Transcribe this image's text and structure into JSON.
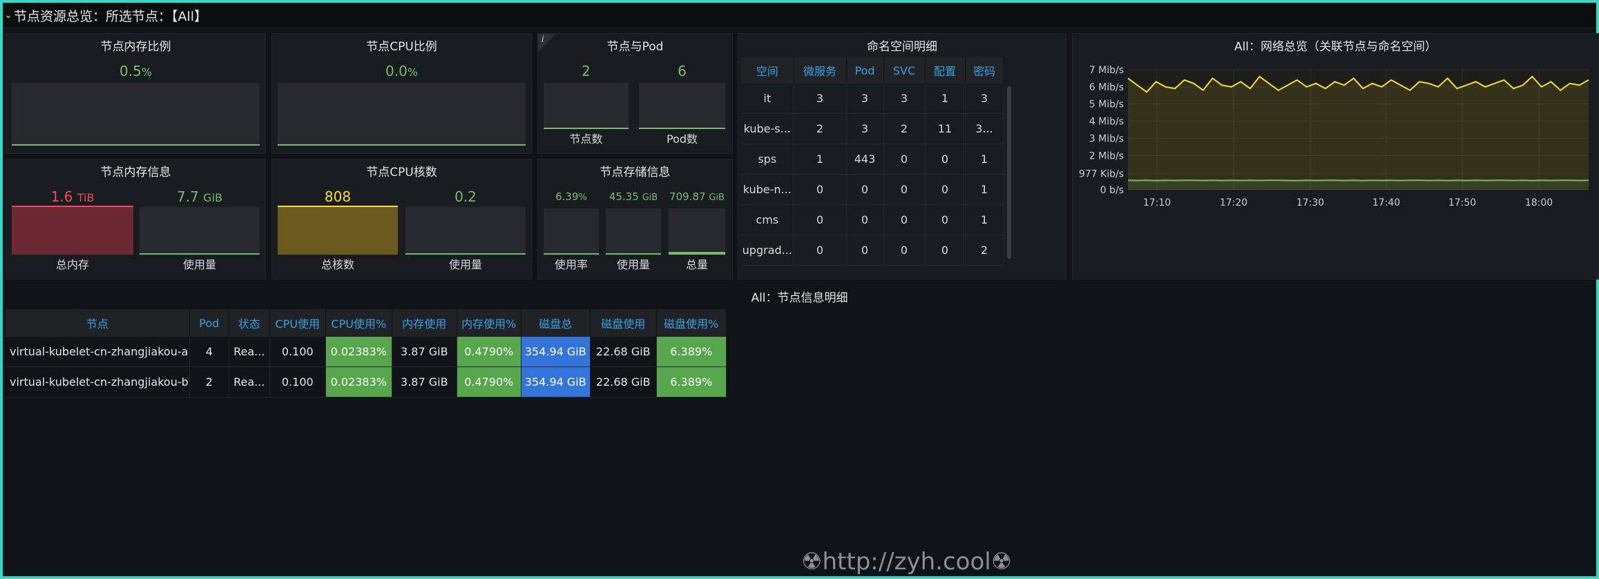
{
  "row": {
    "title": "节点资源总览：所选节点：【All】"
  },
  "mem_ratio": {
    "title": "节点内存比例",
    "value": "0.5",
    "unit": "%",
    "percent": 0.5
  },
  "cpu_ratio": {
    "title": "节点CPU比例",
    "value": "0.0",
    "unit": "%",
    "percent": 0.0
  },
  "node_pod": {
    "title": "节点与Pod",
    "info": "i",
    "nodes": {
      "value": "2",
      "label": "节点数"
    },
    "pods": {
      "value": "6",
      "label": "Pod数"
    }
  },
  "mem_info": {
    "title": "节点内存信息",
    "total": {
      "value": "1.6",
      "unit": "TiB",
      "label": "总内存",
      "color": "#f2495c"
    },
    "used": {
      "value": "7.7",
      "unit": "GiB",
      "label": "使用量"
    }
  },
  "cpu_cores": {
    "title": "节点CPU核数",
    "total": {
      "value": "808",
      "label": "总核数",
      "color": "#fade2a"
    },
    "used": {
      "value": "0.2",
      "label": "使用量"
    }
  },
  "storage": {
    "title": "节点存储信息",
    "rate": {
      "value": "6.39",
      "unit": "%",
      "label": "使用率"
    },
    "used": {
      "value": "45.35",
      "unit": "GiB",
      "label": "使用量"
    },
    "total": {
      "value": "709.87",
      "unit": "GiB",
      "label": "总量"
    }
  },
  "namespaces": {
    "title": "命名空间明细",
    "columns": [
      "空间",
      "微服务",
      "Pod",
      "SVC",
      "配置",
      "密码"
    ],
    "rows": [
      [
        "it",
        "3",
        "3",
        "3",
        "1",
        "3"
      ],
      [
        "kube-s...",
        "2",
        "3",
        "2",
        "11",
        "3..."
      ],
      [
        "sps",
        "1",
        "443",
        "0",
        "0",
        "1"
      ],
      [
        "kube-n...",
        "0",
        "0",
        "0",
        "0",
        "1"
      ],
      [
        "cms",
        "0",
        "0",
        "0",
        "0",
        "1"
      ],
      [
        "upgrad...",
        "0",
        "0",
        "0",
        "0",
        "2"
      ]
    ]
  },
  "network": {
    "title": "All：网络总览（关联节点与命名空间）"
  },
  "chart_data": {
    "type": "line",
    "title": "All：网络总览（关联节点与命名空间）",
    "y_ticks": [
      "7 Mib/s",
      "6 Mib/s",
      "5 Mib/s",
      "4 Mib/s",
      "3 Mib/s",
      "2 Mib/s",
      "977 Kib/s",
      "0 b/s"
    ],
    "x_ticks": [
      "17:10",
      "17:20",
      "17:30",
      "17:40",
      "17:50",
      "18:00"
    ],
    "ylim_mibps": [
      0,
      7
    ],
    "series": [
      {
        "color": "#fade2a",
        "values_mibps": [
          6.5,
          6.1,
          5.7,
          6.3,
          6.0,
          5.9,
          6.4,
          6.2,
          5.8,
          6.5,
          6.1,
          6.0,
          6.3,
          5.9,
          6.6,
          6.2,
          5.8,
          6.1,
          6.4,
          6.0,
          6.2,
          5.9,
          6.3,
          6.1,
          6.5,
          5.9,
          6.2,
          6.0,
          6.4,
          6.1,
          5.8,
          6.3,
          6.2,
          6.0,
          6.5,
          5.9,
          6.1,
          6.3,
          6.0,
          6.2,
          6.4,
          5.9,
          6.1,
          6.6,
          6.0,
          6.3,
          5.8,
          6.2,
          6.1,
          6.4
        ]
      },
      {
        "color": "#73bf69",
        "values_mibps": [
          0.55,
          0.54,
          0.55,
          0.53,
          0.55,
          0.54,
          0.55,
          0.55,
          0.54,
          0.55,
          0.53,
          0.55,
          0.54,
          0.55,
          0.54,
          0.55,
          0.55,
          0.54,
          0.53,
          0.55,
          0.54,
          0.55,
          0.55,
          0.54,
          0.55,
          0.53,
          0.55,
          0.54,
          0.55,
          0.54,
          0.55,
          0.55,
          0.54,
          0.55,
          0.53,
          0.55,
          0.54,
          0.55,
          0.54,
          0.55,
          0.55,
          0.54,
          0.55,
          0.53,
          0.55,
          0.54,
          0.55,
          0.55,
          0.54,
          0.55
        ]
      }
    ]
  },
  "nodes": {
    "title": "All：节点信息明细",
    "columns": [
      "节点",
      "Pod",
      "状态",
      "CPU使用",
      "CPU使用%",
      "内存使用",
      "内存使用%",
      "磁盘总",
      "磁盘使用",
      "磁盘使用%"
    ],
    "rows": [
      [
        "virtual-kubelet-cn-zhangjiakou-a",
        "4",
        "Rea...",
        "0.100",
        "0.02383%",
        "3.87 GiB",
        "0.4790%",
        "354.94 GiB",
        "22.68 GiB",
        "6.389%"
      ],
      [
        "virtual-kubelet-cn-zhangjiakou-b",
        "2",
        "Rea...",
        "0.100",
        "0.02383%",
        "3.87 GiB",
        "0.4790%",
        "354.94 GiB",
        "22.68 GiB",
        "6.389%"
      ]
    ]
  },
  "watermark": "☢http://zyh.cool☢"
}
